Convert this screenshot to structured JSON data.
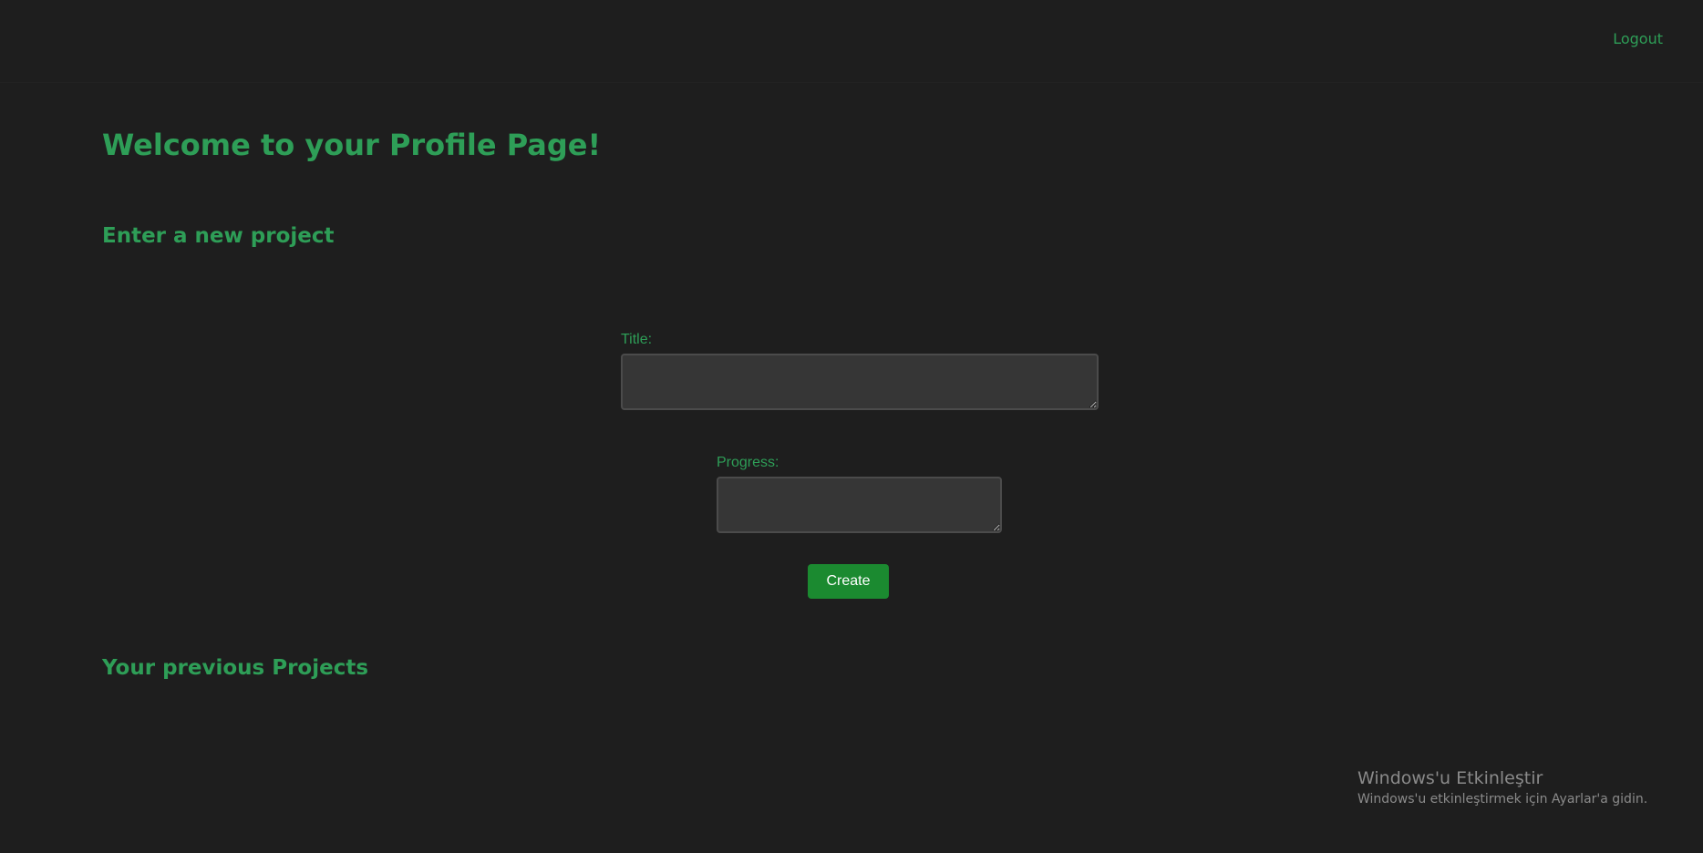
{
  "header": {
    "logout_label": "Logout"
  },
  "main": {
    "page_title": "Welcome to your Profile Page!",
    "new_project_heading": "Enter a new project",
    "form": {
      "title_label": "Title:",
      "title_value": "",
      "progress_label": "Progress:",
      "progress_value": "",
      "create_label": "Create"
    },
    "previous_projects_heading": "Your previous Projects"
  },
  "watermark": {
    "title": "Windows'u Etkinleştir",
    "subtitle": "Windows'u etkinleştirmek için Ayarlar'a gidin."
  },
  "colors": {
    "background": "#1e1e1e",
    "accent": "#2e9e57",
    "button": "#1b8a30",
    "input_bg": "#363636"
  }
}
